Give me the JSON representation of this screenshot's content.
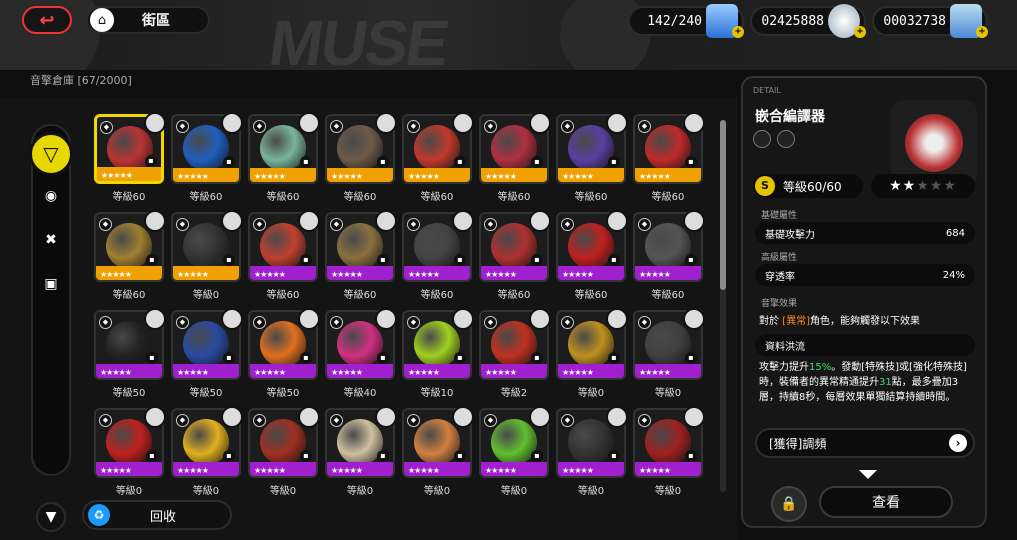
{
  "topbar": {
    "home_label": "街區",
    "battery": "142/240",
    "dennies": "02425888",
    "tickets": "00032738"
  },
  "inventory": {
    "title": "音擎倉庫 [67/2000]"
  },
  "sidebar": {
    "icons": [
      "w-engine-icon",
      "disc-icon",
      "bangboo-icon",
      "safe-icon"
    ]
  },
  "bottom": {
    "recycle_label": "回收"
  },
  "colors": {
    "accent": "#e6d800",
    "purple": "#a020d0",
    "orange": "#f0a000"
  },
  "items": [
    {
      "level": "等級60",
      "rank": "orange",
      "color": "#b33",
      "sel": true
    },
    {
      "level": "等級60",
      "rank": "orange",
      "color": "#1f5fbf"
    },
    {
      "level": "等級60",
      "rank": "orange",
      "color": "#7ab59a"
    },
    {
      "level": "等級60",
      "rank": "orange",
      "color": "#6e5a4a"
    },
    {
      "level": "等級60",
      "rank": "orange",
      "color": "#c0392b"
    },
    {
      "level": "等級60",
      "rank": "orange",
      "color": "#b03040"
    },
    {
      "level": "等級60",
      "rank": "orange",
      "color": "#5a3fa0"
    },
    {
      "level": "等級60",
      "rank": "orange",
      "color": "#c02a2a"
    },
    {
      "level": "等級60",
      "rank": "orange",
      "color": "#a08030"
    },
    {
      "level": "等級0",
      "rank": "orange",
      "color": "#333"
    },
    {
      "level": "等級60",
      "rank": "purple",
      "color": "#c04030"
    },
    {
      "level": "等級60",
      "rank": "purple",
      "color": "#8a7040"
    },
    {
      "level": "等級60",
      "rank": "purple",
      "color": "#444"
    },
    {
      "level": "等級60",
      "rank": "purple",
      "color": "#b03030"
    },
    {
      "level": "等級60",
      "rank": "purple",
      "color": "#c02020"
    },
    {
      "level": "等級60",
      "rank": "purple",
      "color": "#555"
    },
    {
      "level": "等級50",
      "rank": "purple",
      "color": "#222"
    },
    {
      "level": "等級50",
      "rank": "purple",
      "color": "#2a4aa0"
    },
    {
      "level": "等級50",
      "rank": "purple",
      "color": "#e07020"
    },
    {
      "level": "等級40",
      "rank": "purple",
      "color": "#d03080"
    },
    {
      "level": "等級10",
      "rank": "purple",
      "color": "#a0d020"
    },
    {
      "level": "等級2",
      "rank": "purple",
      "color": "#c03020"
    },
    {
      "level": "等級0",
      "rank": "purple",
      "color": "#c09020"
    },
    {
      "level": "等級0",
      "rank": "purple",
      "color": "#404040"
    },
    {
      "level": "等級0",
      "rank": "purple",
      "color": "#c02020"
    },
    {
      "level": "等級0",
      "rank": "purple",
      "color": "#e0b020"
    },
    {
      "level": "等級0",
      "rank": "purple",
      "color": "#a03020"
    },
    {
      "level": "等級0",
      "rank": "purple",
      "color": "#d0c0a0"
    },
    {
      "level": "等級0",
      "rank": "purple",
      "color": "#d08040"
    },
    {
      "level": "等級0",
      "rank": "purple",
      "color": "#60c030"
    },
    {
      "level": "等級0",
      "rank": "purple",
      "color": "#333"
    },
    {
      "level": "等級0",
      "rank": "purple",
      "color": "#a02020"
    }
  ],
  "detail": {
    "label": "DETAIL",
    "name": "嵌合編譯器",
    "level": "等級60/60",
    "star_filled": "★★",
    "star_empty": "★★★",
    "base_title": "基礎屬性",
    "base_stat": "基礎攻擊力",
    "base_value": "684",
    "adv_title": "高級屬性",
    "adv_stat": "穿透率",
    "adv_value": "24%",
    "effect_title": "音擎效果",
    "effect_line_pre": "對於 ",
    "effect_line_hl": "[異常]",
    "effect_line_post": "角色，能夠觸發以下效果",
    "skill_name": "資料洪流",
    "skill_p1": "攻擊力提升",
    "skill_pct": "15%",
    "skill_p2": "。發動[特殊技]或[強化特殊技]時，裝備者的異常精通提升",
    "skill_num": "31",
    "skill_p3": "點，最多疊加3層，持續8秒，每層效果單獨結算持續時間。",
    "obtain_label": "[獲得]調頻",
    "view_label": "查看"
  }
}
